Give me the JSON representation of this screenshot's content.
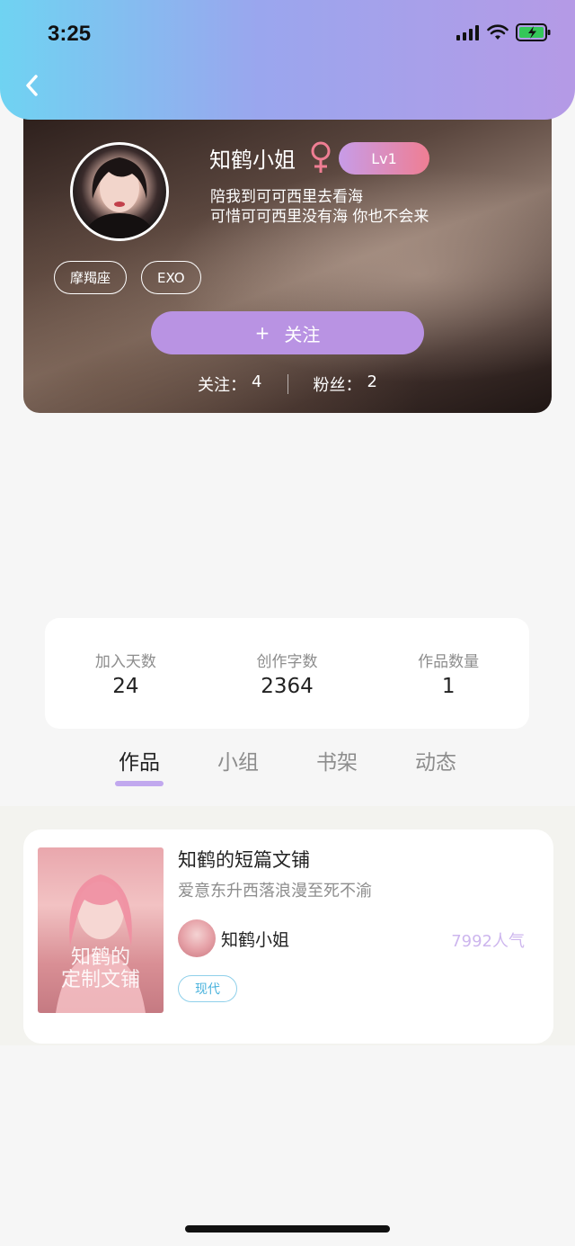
{
  "status_bar": {
    "time": "3:25"
  },
  "profile": {
    "username": "知鹤小姐",
    "gender_icon": "female-icon",
    "level": "Lv1",
    "bio_line1": "陪我到可可西里去看海",
    "bio_line2": "可惜可可西里没有海 你也不会来",
    "tags": [
      "摩羯座",
      "EXO"
    ],
    "follow_plus": "+",
    "follow_label": "关注",
    "following_label": "关注：",
    "following_count": "4",
    "fans_label": "粉丝：",
    "fans_count": "2"
  },
  "stats": [
    {
      "label": "加入天数",
      "value": "24"
    },
    {
      "label": "创作字数",
      "value": "2364"
    },
    {
      "label": "作品数量",
      "value": "1"
    }
  ],
  "tabs": [
    {
      "label": "作品",
      "active": true
    },
    {
      "label": "小组",
      "active": false
    },
    {
      "label": "书架",
      "active": false
    },
    {
      "label": "动态",
      "active": false
    }
  ],
  "work": {
    "cover_text_line1": "知鹤的",
    "cover_text_line2": "定制文铺",
    "title": "知鹤的短篇文铺",
    "description": "爱意东升西落浪漫至死不渝",
    "author": "知鹤小姐",
    "popularity": "7992人气",
    "genre": "现代"
  },
  "colors": {
    "accent_purple": "#b993e3",
    "header_start": "#6fd3f2",
    "header_end": "#b59ae6",
    "gender_pink": "#ef7e93",
    "genre_blue": "#4ab3dd"
  }
}
